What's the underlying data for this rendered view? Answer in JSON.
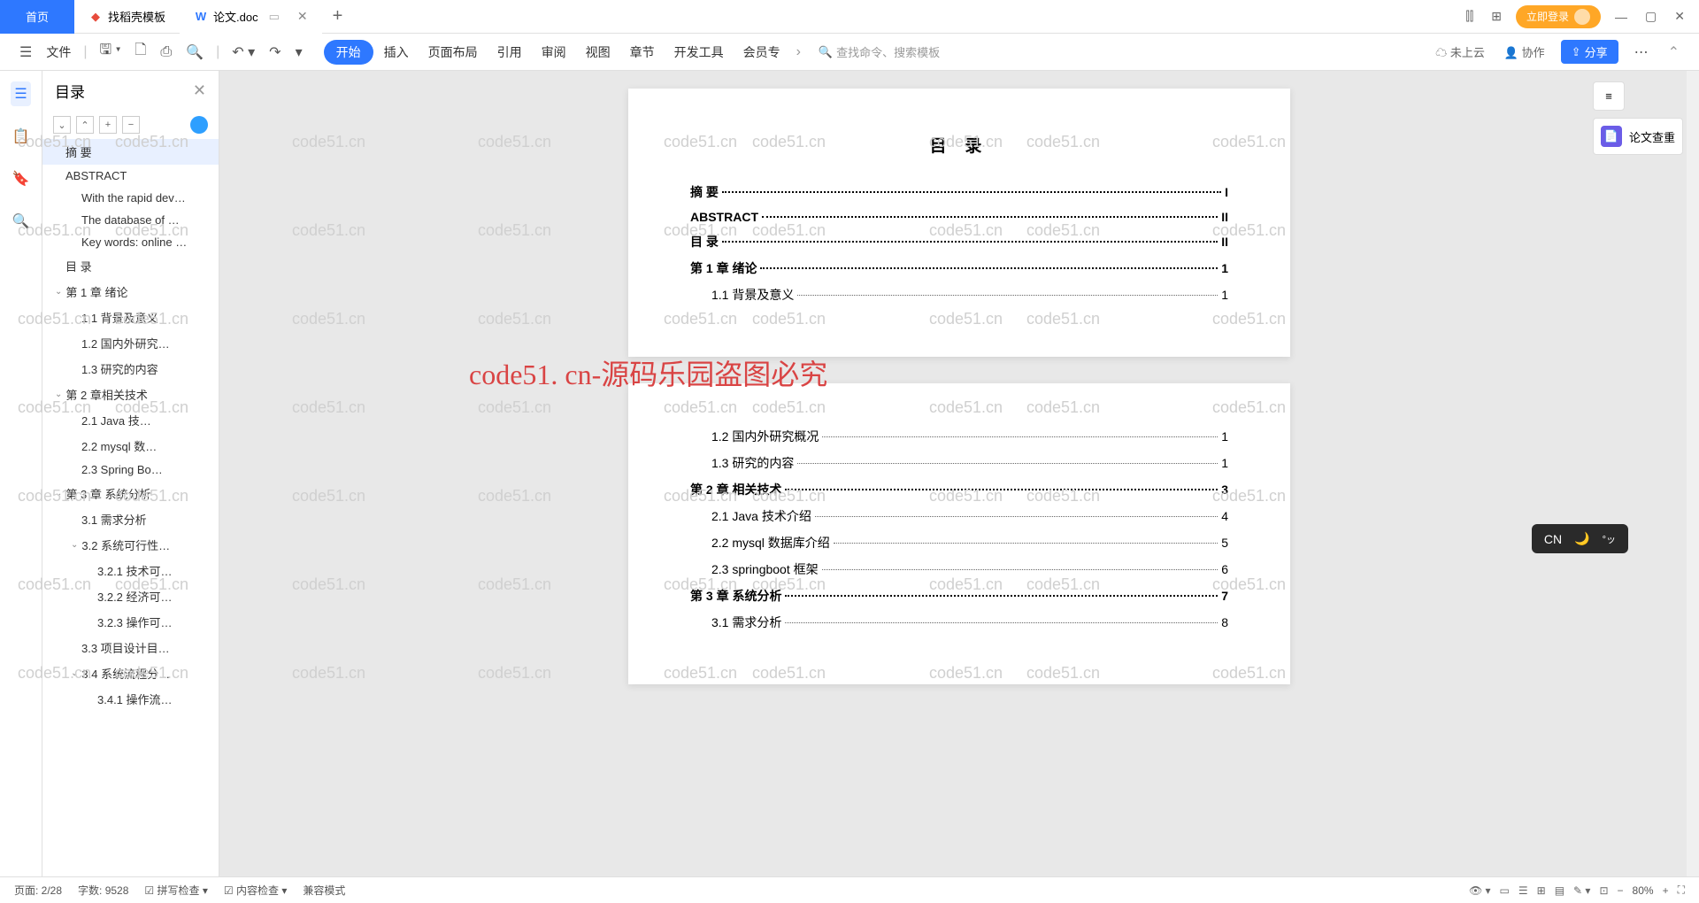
{
  "tabs": {
    "home": "首页",
    "template": "找稻壳模板",
    "doc": "论文.doc",
    "add": "+"
  },
  "titleRight": {
    "login": "立即登录"
  },
  "toolbar": {
    "file": "文件",
    "menu": [
      "开始",
      "插入",
      "页面布局",
      "引用",
      "审阅",
      "视图",
      "章节",
      "开发工具",
      "会员专"
    ],
    "searchPlaceholder": "查找命令、搜索模板",
    "cloud": "未上云",
    "collab": "协作",
    "share": "分享"
  },
  "outline": {
    "title": "目录",
    "items": [
      {
        "t": "摘  要",
        "lvl": 0,
        "sel": true,
        "b": true
      },
      {
        "t": "ABSTRACT",
        "lvl": 0,
        "b": true
      },
      {
        "t": "With the rapid dev…",
        "lvl": 1
      },
      {
        "t": "The database of …",
        "lvl": 1
      },
      {
        "t": "Key words: online …",
        "lvl": 1
      },
      {
        "t": "目 录",
        "lvl": 0,
        "b": true
      },
      {
        "t": "第 1 章 绪论",
        "lvl": 0,
        "chev": true,
        "b": true
      },
      {
        "t": "1.1 背景及意义",
        "lvl": 1
      },
      {
        "t": "1.2 国内外研究…",
        "lvl": 1
      },
      {
        "t": "1.3 研究的内容",
        "lvl": 1
      },
      {
        "t": "第 2 章相关技术",
        "lvl": 0,
        "chev": true,
        "b": true
      },
      {
        "t": "2.1  Java 技…",
        "lvl": 1
      },
      {
        "t": "2.2 mysql 数…",
        "lvl": 1
      },
      {
        "t": "2.3 Spring   Bo…",
        "lvl": 1
      },
      {
        "t": "第 3 章 系统分析",
        "lvl": 0,
        "chev": true,
        "b": true
      },
      {
        "t": "3.1 需求分析",
        "lvl": 1
      },
      {
        "t": "3.2 系统可行性…",
        "lvl": 1,
        "chev": true
      },
      {
        "t": "3.2.1 技术可…",
        "lvl": 2
      },
      {
        "t": "3.2.2 经济可…",
        "lvl": 2
      },
      {
        "t": "3.2.3 操作可…",
        "lvl": 2
      },
      {
        "t": "3.3 项目设计目…",
        "lvl": 1
      },
      {
        "t": "3.4 系统流程分…",
        "lvl": 1,
        "chev": true
      },
      {
        "t": "3.4.1 操作流…",
        "lvl": 2
      }
    ]
  },
  "document": {
    "title": "目 录",
    "page1": [
      {
        "label": "摘  要",
        "page": "I"
      },
      {
        "label": "ABSTRACT",
        "page": "II"
      },
      {
        "label": "目 录",
        "page": "II"
      },
      {
        "label": "第 1 章 绪论",
        "page": "1"
      },
      {
        "label": "1.1 背景及意义",
        "page": "1",
        "sub": true
      }
    ],
    "page2": [
      {
        "label": "1.2 国内外研究概况",
        "page": "1",
        "sub": true
      },
      {
        "label": "1.3 研究的内容",
        "page": "1",
        "sub": true
      },
      {
        "label": "第 2 章 相关技术",
        "page": "3"
      },
      {
        "label": "2.1 Java 技术介绍",
        "page": "4",
        "sub": true
      },
      {
        "label": "2.2 mysql 数据库介绍",
        "page": "5",
        "sub": true
      },
      {
        "label": "2.3 springboot 框架",
        "page": "6",
        "sub": true
      },
      {
        "label": "第 3 章 系统分析",
        "page": "7"
      },
      {
        "label": "3.1 需求分析",
        "page": "8",
        "sub": true
      }
    ]
  },
  "rightPanel": {
    "check": "论文查重"
  },
  "statusBar": {
    "page": "页面: 2/28",
    "words": "字数: 9528",
    "spell": "拼写检查",
    "content": "内容检查",
    "compat": "兼容模式",
    "zoom": "80%"
  },
  "watermarkBig": "code51. cn-源码乐园盗图必究",
  "watermarkSmall": "code51.cn",
  "ime": "CN"
}
